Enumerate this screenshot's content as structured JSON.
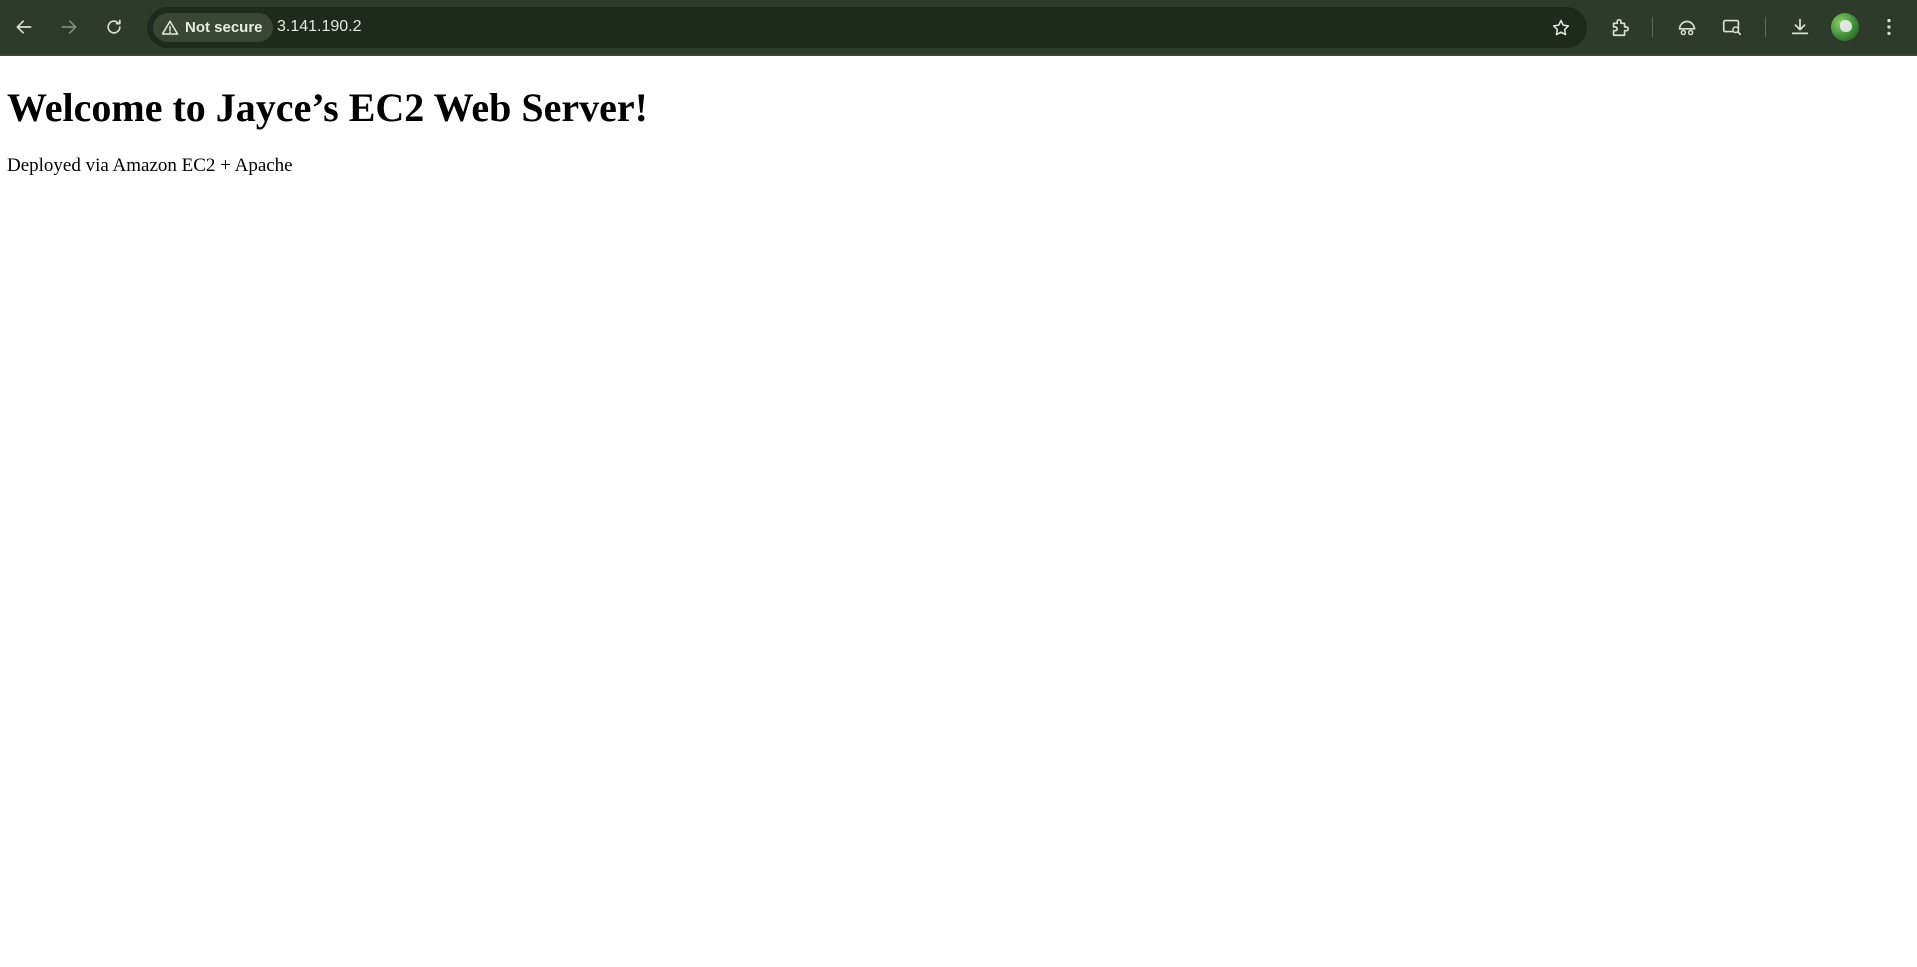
{
  "browser": {
    "security_label": "Not secure",
    "url": "3.141.190.2",
    "toolbar_color": "#2e3b2a",
    "omnibox_color": "#1e2b1c",
    "icons": {
      "back": "arrow-left-icon",
      "forward": "arrow-right-icon",
      "reload": "reload-icon",
      "warning": "warning-triangle-icon",
      "bookmark": "star-icon",
      "extensions": "puzzle-icon",
      "performance": "gauge-icon",
      "media": "media-search-icon",
      "downloads": "download-icon",
      "profile": "avatar",
      "menu": "more-vertical-icon"
    }
  },
  "page": {
    "heading": "Welcome to Jayce’s EC2 Web Server!",
    "subtext": "Deployed via Amazon EC2 + Apache"
  }
}
